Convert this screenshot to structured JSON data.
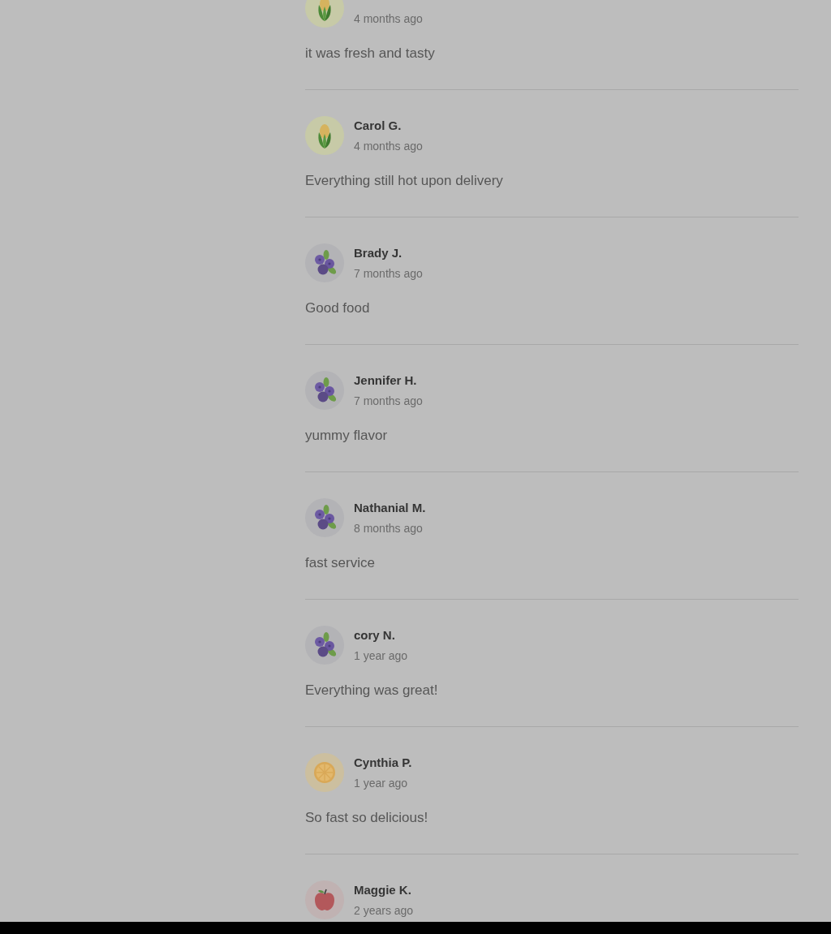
{
  "reviews": [
    {
      "kind": "corn",
      "date": "4 months ago",
      "comment": "it was fresh and tasty"
    },
    {
      "kind": "corn",
      "name": "Carol G.",
      "date": "4 months ago",
      "comment": "Everything still hot upon delivery"
    },
    {
      "kind": "blueberries",
      "name": "Brady J.",
      "date": "7 months ago",
      "comment": "Good food"
    },
    {
      "kind": "blueberries",
      "name": "Jennifer H.",
      "date": "7 months ago",
      "comment": "yummy flavor"
    },
    {
      "kind": "blueberries",
      "name": "Nathanial M.",
      "date": "8 months ago",
      "comment": "fast service"
    },
    {
      "kind": "blueberries",
      "name": "cory N.",
      "date": "1 year ago",
      "comment": "Everything was great!"
    },
    {
      "kind": "citrus",
      "name": "Cynthia P.",
      "date": "1 year ago",
      "comment": "So fast so delicious!"
    },
    {
      "kind": "apple",
      "name": "Maggie K.",
      "date": "2 years ago"
    }
  ]
}
